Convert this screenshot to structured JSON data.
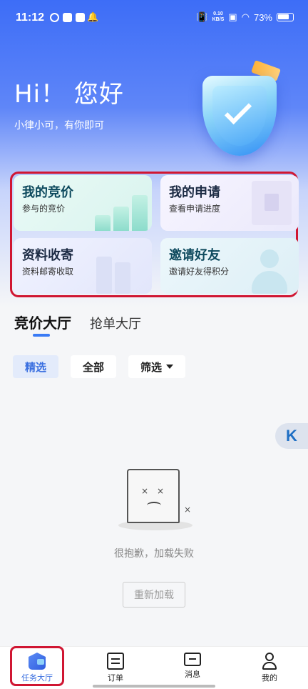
{
  "status_bar": {
    "time": "11:12",
    "net_speed_value": "0.10",
    "net_speed_unit": "KB/S",
    "battery": "73%"
  },
  "hero": {
    "greeting": "Hi！ 您好",
    "subtitle": "小律小可，有你即可"
  },
  "cards": [
    {
      "title": "我的竞价",
      "subtitle": "参与的竞价"
    },
    {
      "title": "我的申请",
      "subtitle": "查看申请进度"
    },
    {
      "title": "资料收寄",
      "subtitle": "资料邮寄收取"
    },
    {
      "title": "邀请好友",
      "subtitle": "邀请好友得积分"
    }
  ],
  "tabs": [
    {
      "label": "竞价大厅",
      "active": true
    },
    {
      "label": "抢单大厅",
      "active": false
    }
  ],
  "filters": {
    "selected": "精选",
    "all": "全部",
    "filter": "筛选"
  },
  "side_logo": {
    "text": "K"
  },
  "empty_state": {
    "message": "很抱歉，加载失败",
    "reload_label": "重新加载"
  },
  "bottom_nav": [
    {
      "label": "任务大厅",
      "icon": "task-hall-icon",
      "active": true
    },
    {
      "label": "订单",
      "icon": "order-icon",
      "active": false
    },
    {
      "label": "消息",
      "icon": "message-icon",
      "active": false
    },
    {
      "label": "我的",
      "icon": "profile-icon",
      "active": false
    }
  ],
  "colors": {
    "accent": "#3a6fe0",
    "highlight_border": "#d01632"
  }
}
